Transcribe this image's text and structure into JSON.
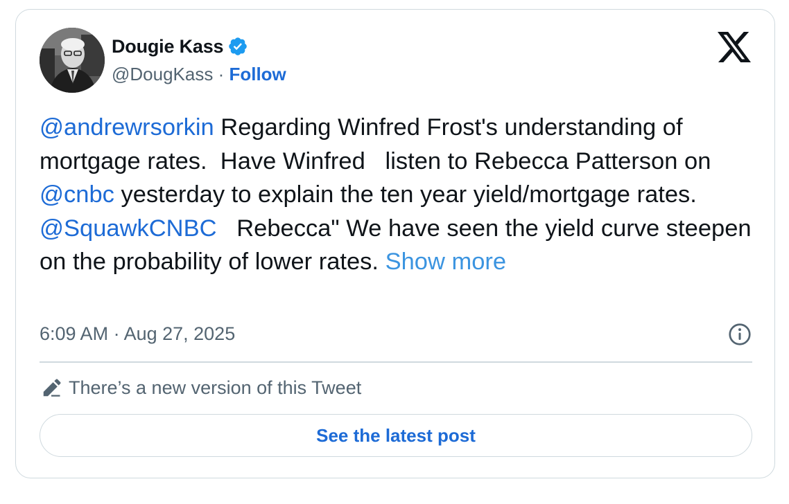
{
  "author": {
    "display_name": "Dougie Kass",
    "handle": "@DougKass",
    "separator": " · ",
    "follow_label": "Follow",
    "verified": true
  },
  "tweet": {
    "segments": [
      {
        "type": "mention",
        "text": "@andrewrsorkin"
      },
      {
        "type": "text",
        "text": " Regarding Winfred Frost's understanding of mortgage rates.  Have Winfred   listen to Rebecca Patterson on "
      },
      {
        "type": "mention",
        "text": "@cnbc"
      },
      {
        "type": "text",
        "text": " yesterday to explain the ten year yield/mortgage rates.    "
      },
      {
        "type": "mention",
        "text": "@SquawkCNBC"
      },
      {
        "type": "text",
        "text": "   Rebecca\" We have seen the yield curve steepen on the probability of lower rates. "
      },
      {
        "type": "show_more",
        "text": "Show more"
      }
    ],
    "timestamp": "6:09 AM · Aug 27, 2025"
  },
  "icons": {
    "avatar": "avatar",
    "verified": "verified-badge-icon",
    "brand": "x-logo-icon",
    "info": "info-icon",
    "edit": "pencil-icon"
  },
  "notice": {
    "text": "There’s a new version of this Tweet",
    "button_label": "See the latest post"
  },
  "colors": {
    "link": "#1d6bd6",
    "show_more": "#3b94e0",
    "muted": "#536471",
    "border": "#cfd9de",
    "verified": "#1d9bf0"
  }
}
